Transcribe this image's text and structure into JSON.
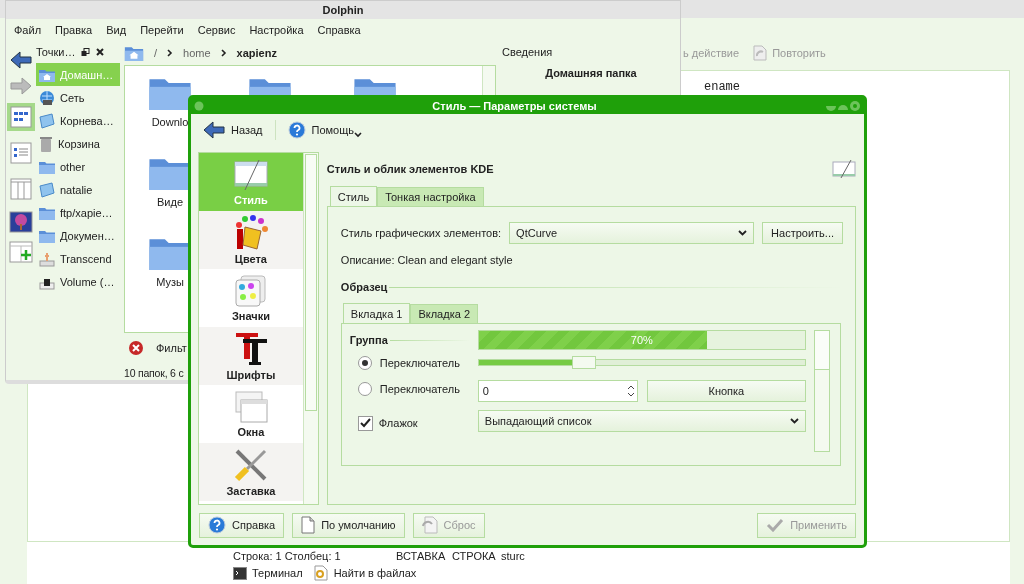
{
  "editor": {
    "toolbar": [
      {
        "label": "ь действие",
        "kind": "undo",
        "disabled": true
      },
      {
        "label": "Повторить",
        "kind": "redo",
        "disabled": true
      }
    ],
    "text": "ename",
    "status": [
      "Строка: 1 Столбец: 1",
      "ВСТАВКА",
      "СТРОКА",
      "sturc"
    ],
    "bottom_tabs": [
      {
        "label": "Терминал",
        "kind": "terminal"
      },
      {
        "label": "Найти в файлах",
        "kind": "search"
      }
    ]
  },
  "dolphin": {
    "title": "Dolphin",
    "menu": [
      "Файл",
      "Правка",
      "Вид",
      "Перейти",
      "Сервис",
      "Настройка",
      "Справка"
    ],
    "view_modes": [
      {
        "kind": "icons",
        "selected": true
      },
      {
        "kind": "details",
        "selected": false
      },
      {
        "kind": "columns",
        "selected": false
      }
    ],
    "places": {
      "title": "Точки…",
      "items": [
        {
          "label": "Домашн…",
          "kind": "home",
          "selected": true
        },
        {
          "label": "Сеть",
          "kind": "network",
          "selected": false
        },
        {
          "label": "Корнева…",
          "kind": "root",
          "selected": false
        },
        {
          "label": "Корзина",
          "kind": "trash",
          "selected": false
        },
        {
          "label": "other",
          "kind": "folder",
          "selected": false
        },
        {
          "label": "natalie",
          "kind": "root",
          "selected": false
        },
        {
          "label": "ftp/xapie…",
          "kind": "folder",
          "selected": false
        },
        {
          "label": "Докумен…",
          "kind": "folder",
          "selected": false
        },
        {
          "label": "Transcend",
          "kind": "usb",
          "selected": false
        },
        {
          "label": "Volume (…",
          "kind": "drive",
          "selected": false
        }
      ]
    },
    "breadcrumb": [
      {
        "label": "/",
        "current": false
      },
      {
        "label": "home",
        "current": false
      },
      {
        "label": "xapienz",
        "current": true
      }
    ],
    "files": [
      {
        "name": "Downlo"
      },
      {
        "name": "Виде"
      },
      {
        "name": "Музы"
      }
    ],
    "info": {
      "title": "Сведения",
      "heading": "Домашняя папка"
    },
    "filter_label": "Фильт",
    "status": "10 папок, 6 с"
  },
  "dialog": {
    "title": "Стиль — Параметры системы",
    "toolbar": [
      {
        "label": "Назад",
        "kind": "back"
      },
      {
        "label": "Помощь",
        "kind": "help"
      }
    ],
    "categories": [
      {
        "label": "Стиль",
        "kind": "style",
        "selected": true
      },
      {
        "label": "Цвета",
        "kind": "colors",
        "selected": false
      },
      {
        "label": "Значки",
        "kind": "icons",
        "selected": false
      },
      {
        "label": "Шрифты",
        "kind": "fonts",
        "selected": false
      },
      {
        "label": "Окна",
        "kind": "windows",
        "selected": false
      },
      {
        "label": "Заставка",
        "kind": "tools",
        "selected": false
      }
    ],
    "heading": "Стиль и облик элементов KDE",
    "tabs": [
      {
        "label": "Стиль",
        "selected": true
      },
      {
        "label": "Тонкая настройка",
        "selected": false
      }
    ],
    "widget_style": {
      "label": "Стиль графических элементов:",
      "value": "QtCurve",
      "button": "Настроить..."
    },
    "description": "Описание: Clean and elegant style",
    "preview": {
      "title": "Образец",
      "tabs": [
        {
          "label": "Вкладка 1",
          "selected": true
        },
        {
          "label": "Вкладка 2",
          "selected": false
        }
      ],
      "group": "Группа",
      "radios": [
        {
          "label": "Переключатель",
          "selected": true
        },
        {
          "label": "Переключатель",
          "selected": false
        }
      ],
      "checkbox": {
        "label": "Флажок",
        "checked": true
      },
      "progress": {
        "level": 0.7,
        "text": "70%"
      },
      "slider": {
        "level": 0.32
      },
      "spinbox": {
        "value": "0"
      },
      "button": "Кнопка",
      "combo": "Выпадающий список"
    },
    "buttons": [
      {
        "label": "Справка",
        "kind": "help",
        "disabled": false
      },
      {
        "label": "По умолчанию",
        "kind": "defaults",
        "disabled": false
      },
      {
        "label": "Сброс",
        "kind": "reset",
        "disabled": true
      },
      {
        "label": "Применить",
        "kind": "apply",
        "disabled": true
      }
    ]
  }
}
